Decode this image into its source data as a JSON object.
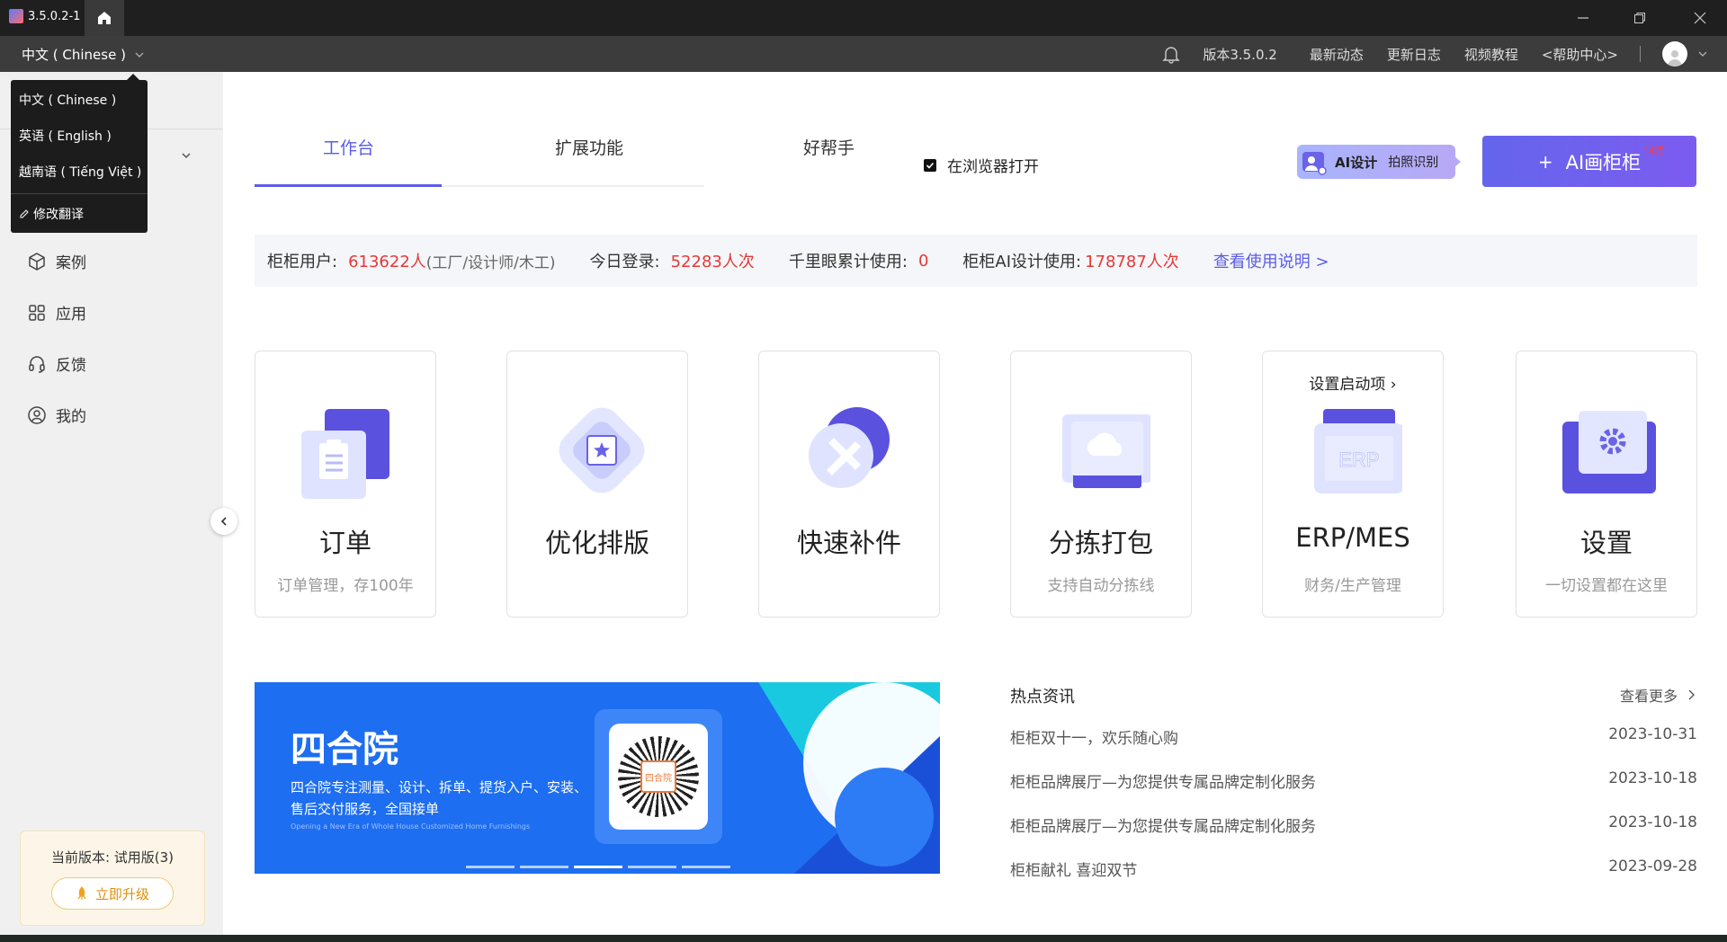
{
  "titlebar": {
    "app_version_tab": "3.5.0.2-1"
  },
  "menubar": {
    "language": "中文 ( Chinese )",
    "version": "版本3.5.0.2",
    "links": [
      "最新动态",
      "更新日志",
      "视频教程",
      "<帮助中心>"
    ]
  },
  "lang_menu": {
    "options": [
      "中文 ( Chinese )",
      "英语 ( English )",
      "越南语 ( Tiếng Việt )"
    ],
    "edit": "修改翻译"
  },
  "sidebar": {
    "items": [
      "案例",
      "应用",
      "反馈",
      "我的"
    ],
    "version_label": "当前版本: 试用版(3)",
    "upgrade": "立即升级"
  },
  "tabs": [
    "工作台",
    "扩展功能",
    "好帮手"
  ],
  "browser_open": "在浏览器打开",
  "ai_design": {
    "label": "AI设计",
    "sub": "拍照识别"
  },
  "ai_cabinet": {
    "label": "AI画柜柜",
    "badge": "试用"
  },
  "stats": {
    "users_label": "柜柜用户:",
    "users_value": "613622人",
    "users_note": "(工厂/设计师/木工)",
    "login_label": "今日登录:",
    "login_value": "52283人次",
    "eye_label": "千里眼累计使用:",
    "eye_value": "0",
    "ai_label": "柜柜AI设计使用:",
    "ai_value": "178787人次",
    "help_link": "查看使用说明 >"
  },
  "cards": [
    {
      "title": "订单",
      "sub": "订单管理，存100年"
    },
    {
      "title": "优化排版",
      "sub": ""
    },
    {
      "title": "快速补件",
      "sub": ""
    },
    {
      "title": "分拣打包",
      "sub": "支持自动分拣线"
    },
    {
      "title": "ERP/MES",
      "sub": "财务/生产管理",
      "top": "设置启动项",
      "erp_text": "ERP"
    },
    {
      "title": "设置",
      "sub": "一切设置都在这里"
    }
  ],
  "banner": {
    "title": "四合院",
    "desc1": "四合院专注测量、设计、拆单、提货入户、安装、",
    "desc2": "售后交付服务，全国接单",
    "en": "Opening a New Era of Whole House Customized Home Furnishings",
    "qr_label": "四合院"
  },
  "news": {
    "title": "热点资讯",
    "more": "查看更多",
    "items": [
      {
        "text": "柜柜双十一，欢乐随心购",
        "date": "2023-10-31"
      },
      {
        "text": "柜柜品牌展厅—为您提供专属品牌定制化服务",
        "date": "2023-10-18"
      },
      {
        "text": "柜柜品牌展厅—为您提供专属品牌定制化服务",
        "date": "2023-10-18"
      },
      {
        "text": "柜柜献礼 喜迎双节",
        "date": "2023-09-28"
      }
    ]
  },
  "colors": {
    "accent": "#5b5ce6",
    "red": "#e53935",
    "link": "#5b5ce6"
  }
}
